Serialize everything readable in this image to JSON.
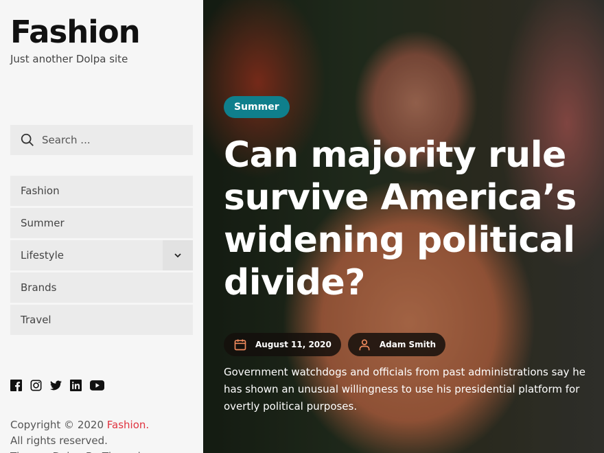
{
  "site": {
    "title": "Fashion",
    "tagline": "Just another Dolpa site"
  },
  "search": {
    "placeholder": "Search ..."
  },
  "nav": [
    {
      "label": "Fashion"
    },
    {
      "label": "Summer"
    },
    {
      "label": "Lifestyle"
    },
    {
      "label": "Brands"
    },
    {
      "label": "Travel"
    }
  ],
  "social": [
    "facebook-icon",
    "instagram-icon",
    "twitter-icon",
    "linkedin-icon",
    "youtube-icon"
  ],
  "footer": {
    "copyright": "Copyright © 2020 ",
    "site_link": "Fashion.",
    "rights": "All rights reserved.",
    "theme": "Theme: Dolpa By Themeinwp"
  },
  "post": {
    "category": "Summer",
    "title": "Can majority rule survive America’s widening political divide?",
    "date": "August 11, 2020",
    "author": "Adam Smith",
    "excerpt": "Government watchdogs and officials from past administrations say he has shown an unusual willingness to use his presidential platform for overtly political purposes."
  },
  "colors": {
    "accent": "#e0333f",
    "badge": "#0f7f8c",
    "meta_icon": "#f08a5d"
  }
}
